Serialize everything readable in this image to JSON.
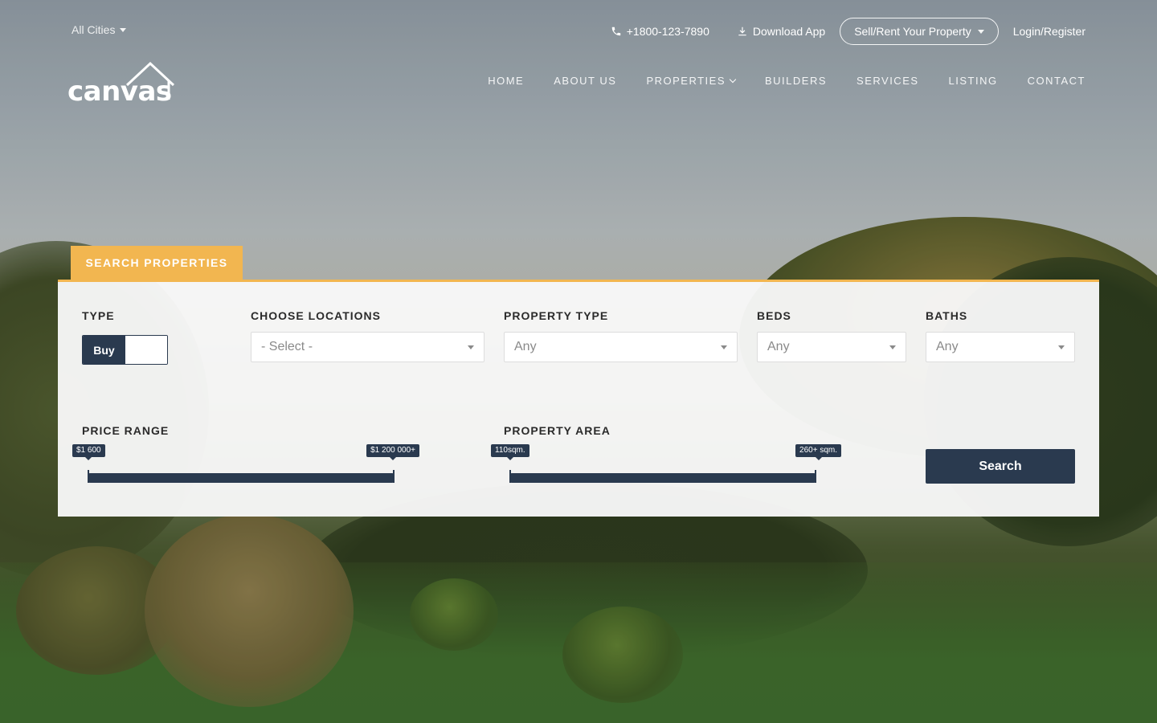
{
  "topbar": {
    "cities_label": "All Cities",
    "phone": "+1800-123-7890",
    "download": "Download App",
    "sell_rent": "Sell/Rent Your Property",
    "login": "Login/Register"
  },
  "logo": {
    "text": "canvas"
  },
  "nav": {
    "items": [
      {
        "label": "HOME"
      },
      {
        "label": "ABOUT US"
      },
      {
        "label": "PROPERTIES"
      },
      {
        "label": "BUILDERS"
      },
      {
        "label": "SERVICES"
      },
      {
        "label": "LISTING"
      },
      {
        "label": "CONTACT"
      }
    ]
  },
  "search": {
    "tab_label": "SEARCH PROPERTIES",
    "type": {
      "label": "TYPE",
      "selected": "Buy"
    },
    "locations": {
      "label": "CHOOSE LOCATIONS",
      "value": "- Select -"
    },
    "property_type": {
      "label": "PROPERTY TYPE",
      "value": "Any"
    },
    "beds": {
      "label": "BEDS",
      "value": "Any"
    },
    "baths": {
      "label": "BATHS",
      "value": "Any"
    },
    "price_range": {
      "label": "PRICE RANGE",
      "min": "$1 600",
      "max": "$1 200 000+"
    },
    "property_area": {
      "label": "PROPERTY AREA",
      "min": "110sqm.",
      "max": "260+ sqm."
    },
    "button": "Search"
  },
  "colors": {
    "accent": "#f2b650",
    "primary": "#2a3a4f"
  }
}
